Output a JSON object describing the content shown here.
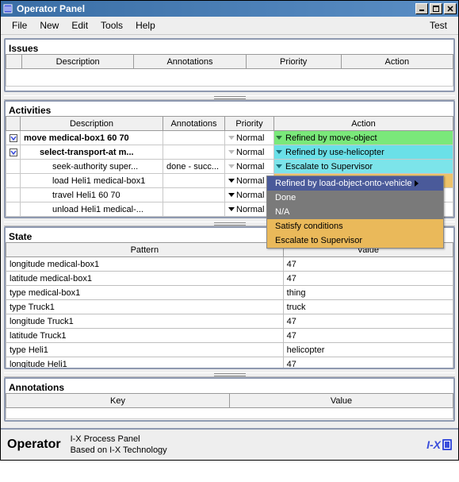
{
  "window": {
    "title": "Operator Panel"
  },
  "menu": {
    "file": "File",
    "new": "New",
    "edit": "Edit",
    "tools": "Tools",
    "help": "Help",
    "test": "Test"
  },
  "sections": {
    "issues": "Issues",
    "activities": "Activities",
    "state": "State",
    "annotations": "Annotations"
  },
  "issues_headers": {
    "description": "Description",
    "annotations": "Annotations",
    "priority": "Priority",
    "action": "Action"
  },
  "activities_headers": {
    "description": "Description",
    "annotations": "Annotations",
    "priority": "Priority",
    "action": "Action"
  },
  "activities": [
    {
      "desc": "move medical-box1 60 70",
      "ann": "",
      "prio": "Normal",
      "prio_dark": false,
      "action": "Refined by move-object",
      "row_class": "row-green",
      "indent": 0,
      "toggle": true,
      "bold": true
    },
    {
      "desc": "select-transport-at m...",
      "ann": "",
      "prio": "Normal",
      "prio_dark": false,
      "action": "Refined by use-helicopter",
      "row_class": "row-cyan",
      "indent": 1,
      "toggle": true,
      "bold": true
    },
    {
      "desc": "seek-authority super...",
      "ann": "done - succ...",
      "prio": "Normal",
      "prio_dark": false,
      "action": "Escalate to Supervisor",
      "row_class": "row-cyan2",
      "indent": 2,
      "toggle": false,
      "bold": false
    },
    {
      "desc": "load Heli1 medical-box1",
      "ann": "",
      "prio": "Normal",
      "prio_dark": true,
      "action": "Refined by load-object-onto-vehicle",
      "row_class": "row-orange",
      "indent": 2,
      "toggle": false,
      "bold": false,
      "action_caret_black": true
    },
    {
      "desc": "travel Heli1 60 70",
      "ann": "",
      "prio": "Normal",
      "prio_dark": true,
      "action": "",
      "row_class": "",
      "indent": 2,
      "toggle": false,
      "bold": false
    },
    {
      "desc": "unload Heli1 medical-...",
      "ann": "",
      "prio": "Normal",
      "prio_dark": true,
      "action": "",
      "row_class": "",
      "indent": 2,
      "toggle": false,
      "bold": false
    }
  ],
  "state_headers": {
    "pattern": "Pattern",
    "value": "Value"
  },
  "state_rows": [
    {
      "pattern": "longitude medical-box1",
      "value": "47"
    },
    {
      "pattern": "latitude medical-box1",
      "value": "47"
    },
    {
      "pattern": "type medical-box1",
      "value": "thing"
    },
    {
      "pattern": "type Truck1",
      "value": "truck"
    },
    {
      "pattern": "longitude Truck1",
      "value": "47"
    },
    {
      "pattern": "latitude Truck1",
      "value": "47"
    },
    {
      "pattern": "type Heli1",
      "value": "helicopter"
    },
    {
      "pattern": "longitude Heli1",
      "value": "47"
    }
  ],
  "annotations_headers": {
    "key": "Key",
    "value": "Value"
  },
  "dropdown": {
    "items": [
      {
        "label": "Refined by load-object-onto-vehicle",
        "style": "selblue",
        "arrow": true
      },
      {
        "label": "Done",
        "style": "sel"
      },
      {
        "label": "N/A",
        "style": "sel"
      },
      {
        "label": "Satisfy conditions",
        "style": "orange"
      },
      {
        "label": "Escalate to Supervisor",
        "style": "orange"
      }
    ]
  },
  "status": {
    "operator": "Operator",
    "line1": "I-X Process Panel",
    "line2": "Based on I-X Technology",
    "ix": "I-X"
  }
}
